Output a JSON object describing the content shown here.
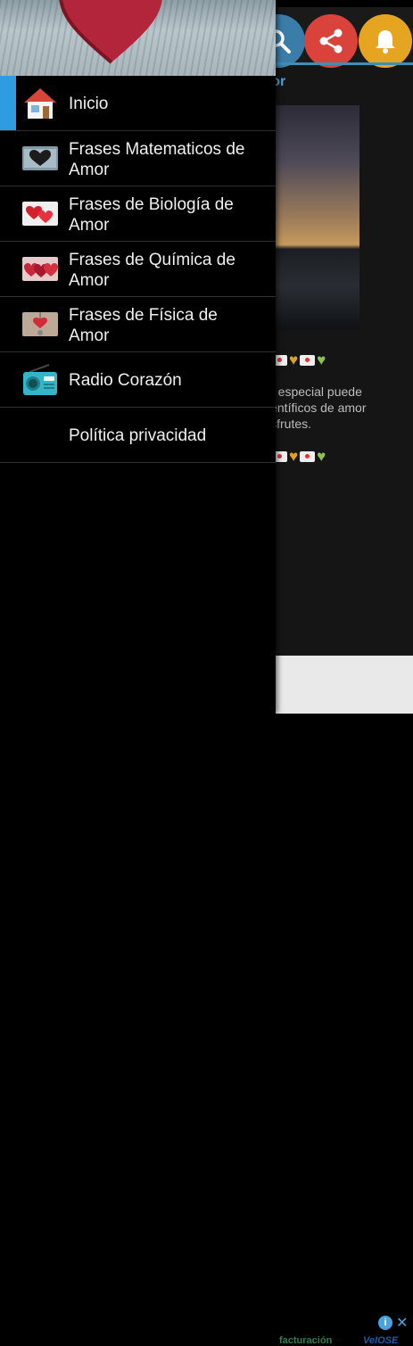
{
  "background_app": {
    "heading_fragment": "mor",
    "body_text": "a especial puede\nientíficos de amor\nisfrutes.",
    "toolbar_icons": [
      "search-icon",
      "share-icon",
      "bell-icon"
    ],
    "colors": {
      "search": "#3a7da8",
      "share": "#d9433c",
      "bell": "#e5a521",
      "accent": "#4aa3df"
    }
  },
  "ad": {
    "brand_left": "facturación",
    "brand_right": "VeIOSE",
    "info_icon": "info-icon",
    "close_icon": "close-icon"
  },
  "drawer": {
    "header_image": "book-heart-photo",
    "items": [
      {
        "label": "Inicio",
        "icon": "house-icon",
        "active": true
      },
      {
        "label": "Frases Matematicos de Amor",
        "line1": "Frases Matematicos de",
        "line2": "Amor",
        "icon": "math-heart-thumbnail"
      },
      {
        "label": "Frases de Biología de Amor",
        "line1": "Frases de Biología de",
        "line2": "Amor",
        "icon": "biology-heart-thumbnail"
      },
      {
        "label": "Frases de Química de Amor",
        "line1": "Frases de Química de",
        "line2": "Amor",
        "icon": "chemistry-heart-thumbnail"
      },
      {
        "label": "Frases de Física de Amor",
        "line1": "Frases de Física de",
        "line2": "Amor",
        "icon": "physics-heart-thumbnail"
      },
      {
        "label": "Radio Corazón",
        "icon": "radio-icon"
      },
      {
        "label": "Política privacidad",
        "icon": ""
      }
    ],
    "accent": "#2f9be0"
  }
}
